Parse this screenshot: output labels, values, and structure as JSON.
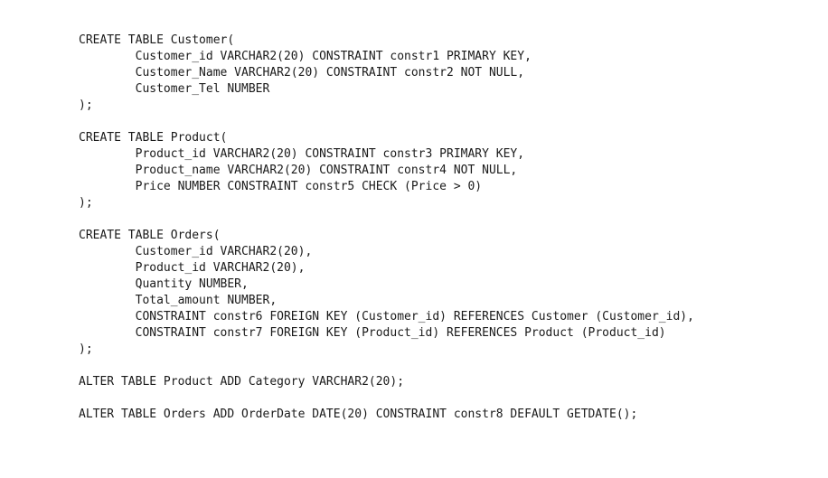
{
  "code": {
    "lines": [
      "CREATE TABLE Customer(",
      "        Customer_id VARCHAR2(20) CONSTRAINT constr1 PRIMARY KEY,",
      "        Customer_Name VARCHAR2(20) CONSTRAINT constr2 NOT NULL,",
      "        Customer_Tel NUMBER",
      ");",
      "",
      "CREATE TABLE Product(",
      "        Product_id VARCHAR2(20) CONSTRAINT constr3 PRIMARY KEY,",
      "        Product_name VARCHAR2(20) CONSTRAINT constr4 NOT NULL,",
      "        Price NUMBER CONSTRAINT constr5 CHECK (Price > 0)",
      ");",
      "",
      "CREATE TABLE Orders(",
      "        Customer_id VARCHAR2(20),",
      "        Product_id VARCHAR2(20),",
      "        Quantity NUMBER,",
      "        Total_amount NUMBER,",
      "        CONSTRAINT constr6 FOREIGN KEY (Customer_id) REFERENCES Customer (Customer_id),",
      "        CONSTRAINT constr7 FOREIGN KEY (Product_id) REFERENCES Product (Product_id)",
      ");",
      "",
      "ALTER TABLE Product ADD Category VARCHAR2(20);",
      "",
      "ALTER TABLE Orders ADD OrderDate DATE(20) CONSTRAINT constr8 DEFAULT GETDATE();"
    ]
  }
}
